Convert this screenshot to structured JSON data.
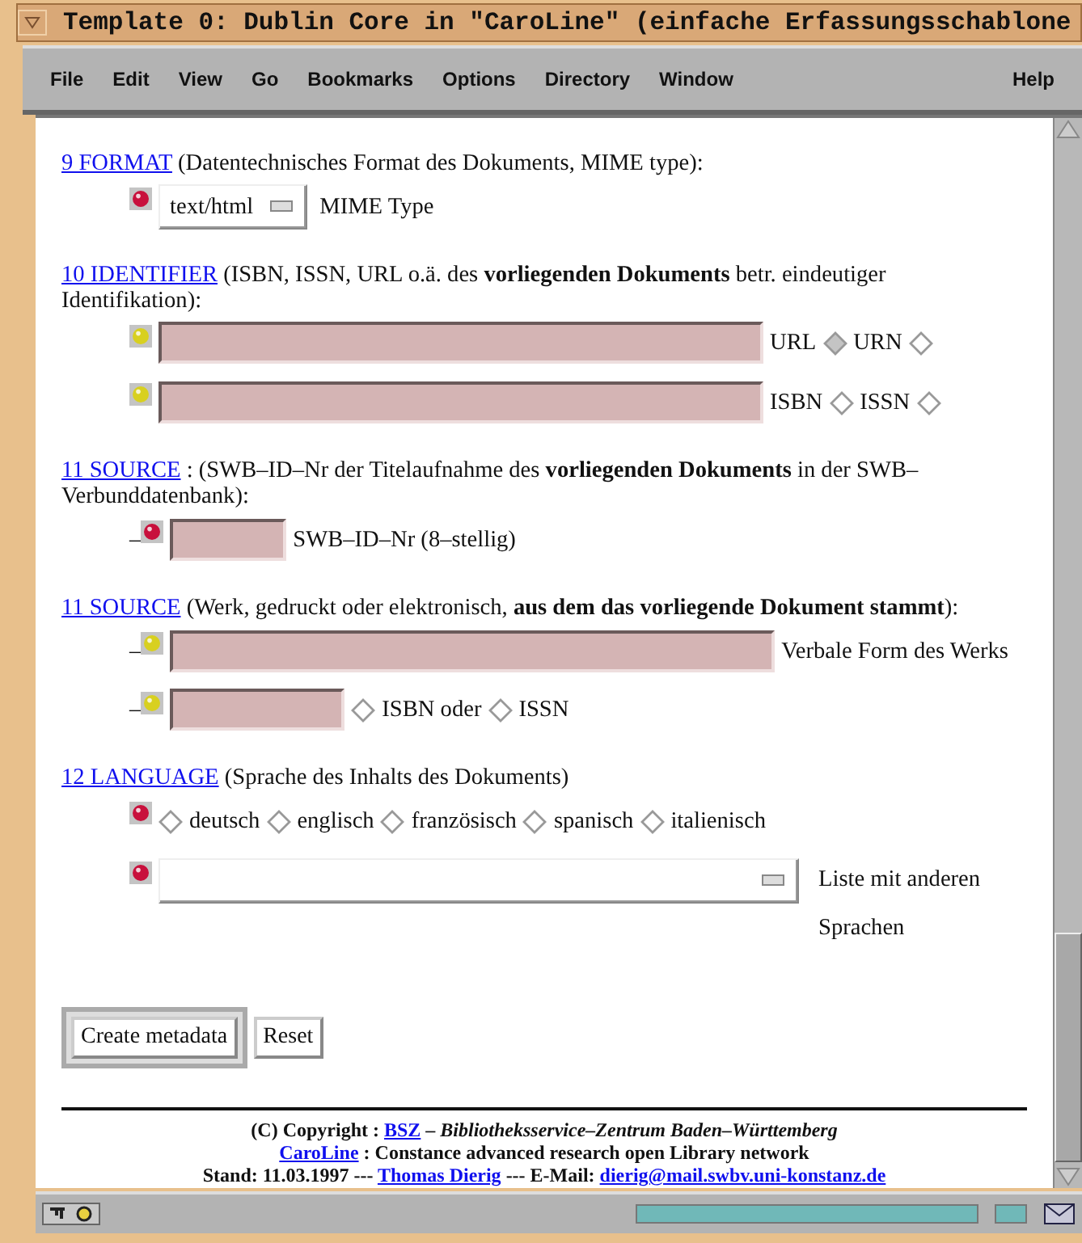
{
  "window": {
    "title": "Template 0: Dublin Core in \"CaroLine\" (einfache Erfassungsschablone"
  },
  "menu": [
    {
      "label": "File"
    },
    {
      "label": "Edit"
    },
    {
      "label": "View"
    },
    {
      "label": "Go"
    },
    {
      "label": "Bookmarks"
    },
    {
      "label": "Options"
    },
    {
      "label": "Directory"
    },
    {
      "label": "Window"
    }
  ],
  "help_menu": "Help",
  "sections": [
    {
      "link": "9 FORMAT",
      "description": "(Datentechnisches Format des Dokuments, MIME type):",
      "rows": [
        {
          "color": "#c8103c",
          "items": [
            {
              "kind": "select",
              "value": "text/html"
            },
            {
              "kind": "label",
              "text": "MIME Type"
            }
          ]
        }
      ]
    },
    {
      "link": "10 IDENTIFIER",
      "description": "(ISBN, ISSN, URL o.ä. des **vorliegenden Dokuments** betr. eindeutiger Identifikation):",
      "rows": [
        {
          "color": "#d8d020",
          "items": [
            {
              "kind": "long-field"
            },
            {
              "kind": "label",
              "text": "URL"
            },
            {
              "kind": "radio",
              "selected": true
            },
            {
              "kind": "label",
              "text": "URN"
            },
            {
              "kind": "radio",
              "selected": false
            }
          ]
        },
        {
          "color": "#d8d020",
          "items": [
            {
              "kind": "long-field"
            },
            {
              "kind": "label",
              "text": "ISBN"
            },
            {
              "kind": "radio",
              "selected": false
            },
            {
              "kind": "label",
              "text": "ISSN"
            },
            {
              "kind": "radio",
              "selected": false
            }
          ]
        }
      ]
    },
    {
      "link": "11 SOURCE",
      "description": ": (SWB–ID–Nr der Titelaufnahme des **vorliegenden Dokuments** in der SWB–Verbunddatenbank):",
      "rows": [
        {
          "prefix": "–",
          "color": "#c8103c",
          "items": [
            {
              "kind": "short-field"
            },
            {
              "kind": "label",
              "text": "SWB–ID–Nr (8–stellig)"
            }
          ]
        }
      ]
    },
    {
      "link": "11 SOURCE",
      "description": "(Werk, gedruckt oder elektronisch, **aus dem das vorliegende Dokument stammt**):",
      "rows": [
        {
          "prefix": "–",
          "color": "#d8d020",
          "items": [
            {
              "kind": "long-field"
            },
            {
              "kind": "label",
              "text": "Verbale Form des Werks"
            }
          ]
        },
        {
          "prefix": "–",
          "color": "#d8d020",
          "items": [
            {
              "kind": "mid-field"
            },
            {
              "kind": "radio",
              "selected": false
            },
            {
              "kind": "label",
              "text": "ISBN oder"
            },
            {
              "kind": "radio",
              "selected": false
            },
            {
              "kind": "label",
              "text": "ISSN"
            }
          ]
        }
      ]
    },
    {
      "link": "12 LANGUAGE",
      "description": "(Sprache des Inhalts des Dokuments)",
      "rows": [
        {
          "color": "#c8103c",
          "items": [
            {
              "kind": "radio",
              "selected": false
            },
            {
              "kind": "label",
              "text": "deutsch"
            },
            {
              "kind": "radio",
              "selected": false
            },
            {
              "kind": "label",
              "text": "englisch"
            },
            {
              "kind": "radio",
              "selected": false
            },
            {
              "kind": "label",
              "text": "französisch"
            },
            {
              "kind": "radio",
              "selected": false
            },
            {
              "kind": "label",
              "text": "spanisch"
            },
            {
              "kind": "radio",
              "selected": false
            },
            {
              "kind": "label",
              "text": "italienisch"
            }
          ]
        },
        {
          "color": "#c8103c",
          "items": [
            {
              "kind": "wide-select"
            },
            {
              "kind": "label",
              "text": "Liste mit anderen Sprachen"
            }
          ]
        }
      ]
    }
  ],
  "buttons": [
    {
      "label": "Create metadata",
      "default": true
    },
    {
      "label": "Reset",
      "default": false
    }
  ],
  "footer": [
    [
      {
        "text": "(C) Copyright : "
      },
      {
        "link": "BSZ"
      },
      {
        "text": " – *Bibliotheksservice–Zentrum Baden–Württemberg*"
      }
    ],
    [
      {
        "link": "CaroLine"
      },
      {
        "text": " : Constance advanced research open Library network"
      }
    ],
    [
      {
        "text": "Stand: 11.03.1997 --- "
      },
      {
        "link": "Thomas Dierig"
      },
      {
        "text": " --- E-Mail: "
      },
      {
        "link": "dierig@mail.swbv.uni-konstanz.de"
      }
    ]
  ]
}
